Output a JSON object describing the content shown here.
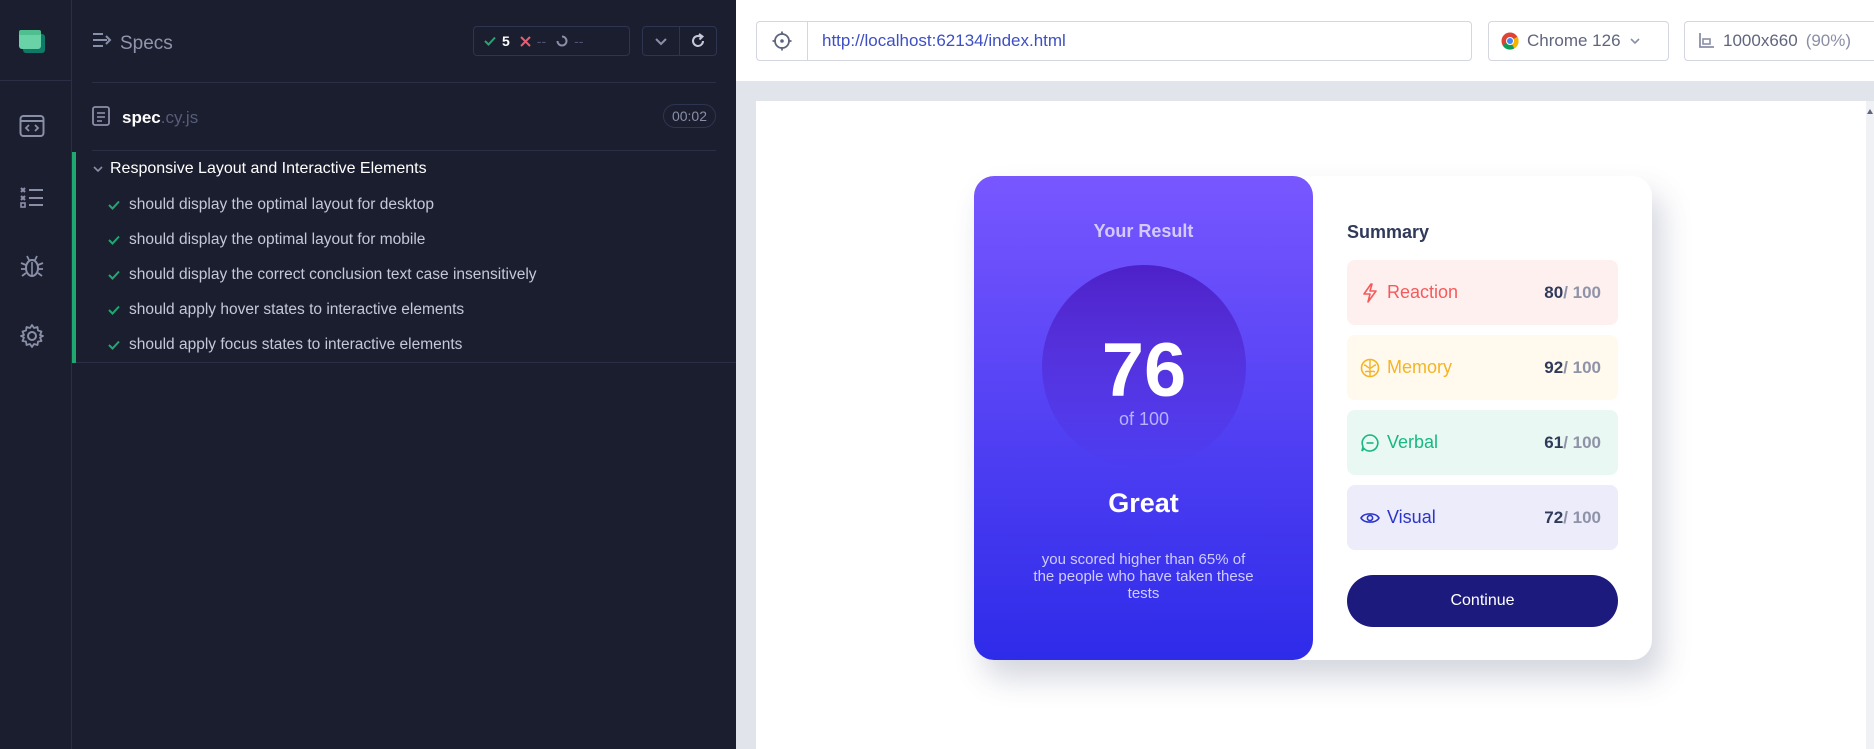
{
  "specs_panel": {
    "title": "Specs",
    "counts": {
      "passed": "5",
      "failed": "--",
      "pending": "--"
    },
    "file": {
      "name": "spec",
      "ext": ".cy.js",
      "duration": "00:02"
    },
    "suite": {
      "title": "Responsive Layout and Interactive Elements",
      "tests": [
        "should display the optimal layout for desktop",
        "should display the optimal layout for mobile",
        "should display the correct conclusion text case insensitively",
        "should apply hover states to interactive elements",
        "should apply focus states to interactive elements"
      ]
    }
  },
  "browser": {
    "url": "http://localhost:62134/index.html",
    "browser_name": "Chrome 126",
    "viewport_size": "1000x660",
    "viewport_scale": "(90%)"
  },
  "result": {
    "title": "Your Result",
    "score": "76",
    "out_of": "of 100",
    "grade": "Great",
    "description": "you scored higher than 65% of the people who have taken these tests"
  },
  "summary": {
    "title": "Summary",
    "items": [
      {
        "name": "Reaction",
        "score": "80",
        "max": " / 100",
        "color": "#f55a5a",
        "bg": "#fff0f0",
        "icon": "lightning-icon"
      },
      {
        "name": "Memory",
        "score": "92",
        "max": " / 100",
        "color": "#f5b422",
        "bg": "#fff9ee",
        "icon": "brain-icon"
      },
      {
        "name": "Verbal",
        "score": "61",
        "max": " / 100",
        "color": "#17b882",
        "bg": "#e9f8f2",
        "icon": "chat-bubble-icon"
      },
      {
        "name": "Visual",
        "score": "72",
        "max": " / 100",
        "color": "#2c34c9",
        "bg": "#ececfb",
        "icon": "eye-icon"
      }
    ],
    "continue_label": "Continue"
  },
  "colors": {
    "pass": "#1fa971",
    "fail": "#f05a6e",
    "accent_link": "#3d4fc4",
    "button": "#1d1a7e"
  }
}
